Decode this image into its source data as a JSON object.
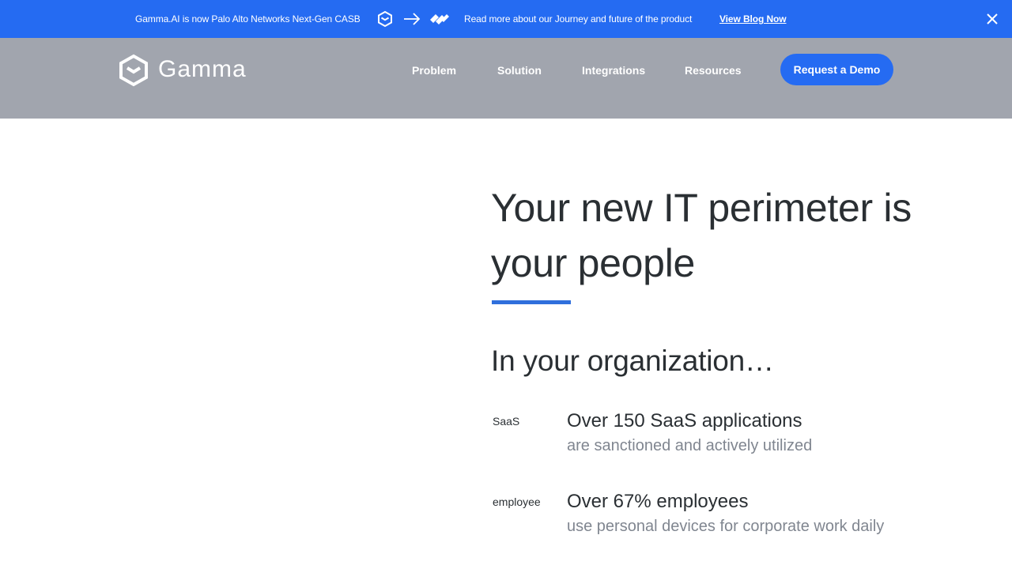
{
  "announcement": {
    "text": "Gamma.AI is now Palo Alto Networks Next-Gen CASB",
    "subtext": "Read more about our Journey and future of the product",
    "link_label": "View Blog Now",
    "icons": [
      "gamma-logo-icon",
      "arrow-right-icon",
      "palo-alto-logo-icon",
      "close-icon"
    ]
  },
  "header": {
    "logo_text": "Gamma",
    "nav": [
      "Problem",
      "Solution",
      "Integrations",
      "Resources"
    ],
    "cta_label": "Request a Demo"
  },
  "hero": {
    "title": "Your new IT perimeter is your people",
    "org_title": "In your organization…",
    "stats": [
      {
        "img_alt": "SaaS",
        "headline": "Over 150 SaaS applications",
        "sub": "are sanctioned and actively utilized"
      },
      {
        "img_alt": "employee",
        "headline": "Over 67% employees",
        "sub": "use personal devices for corporate work daily"
      }
    ]
  },
  "colors": {
    "banner": "#256bf2",
    "header": "#a1a5ae",
    "accent": "#2f6fdc",
    "text_dark": "#2a2f33",
    "text_muted": "#808690"
  }
}
